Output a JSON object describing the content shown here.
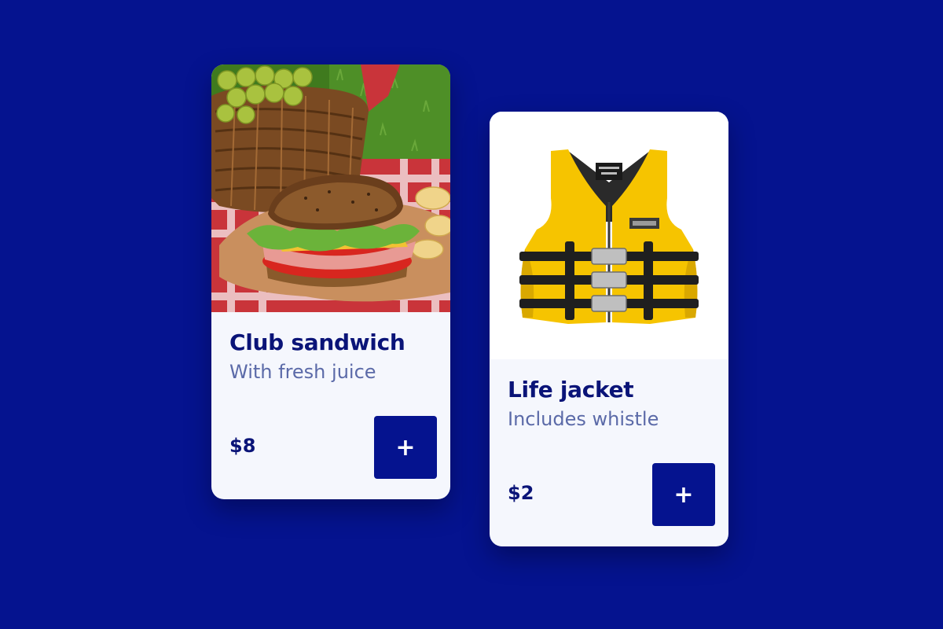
{
  "colors": {
    "background": "#05138f",
    "card_bg": "#f5f7fd",
    "title": "#0a1478",
    "subtitle": "#5b6aa8",
    "button": "#05138f"
  },
  "products": [
    {
      "title": "Club sandwich",
      "subtitle": "With fresh juice",
      "price": "$8",
      "add_label": "+",
      "image": "sandwich-picnic-photo"
    },
    {
      "title": "Life jacket",
      "subtitle": "Includes whistle",
      "price": "$2",
      "add_label": "+",
      "image": "yellow-life-jacket-photo"
    }
  ]
}
